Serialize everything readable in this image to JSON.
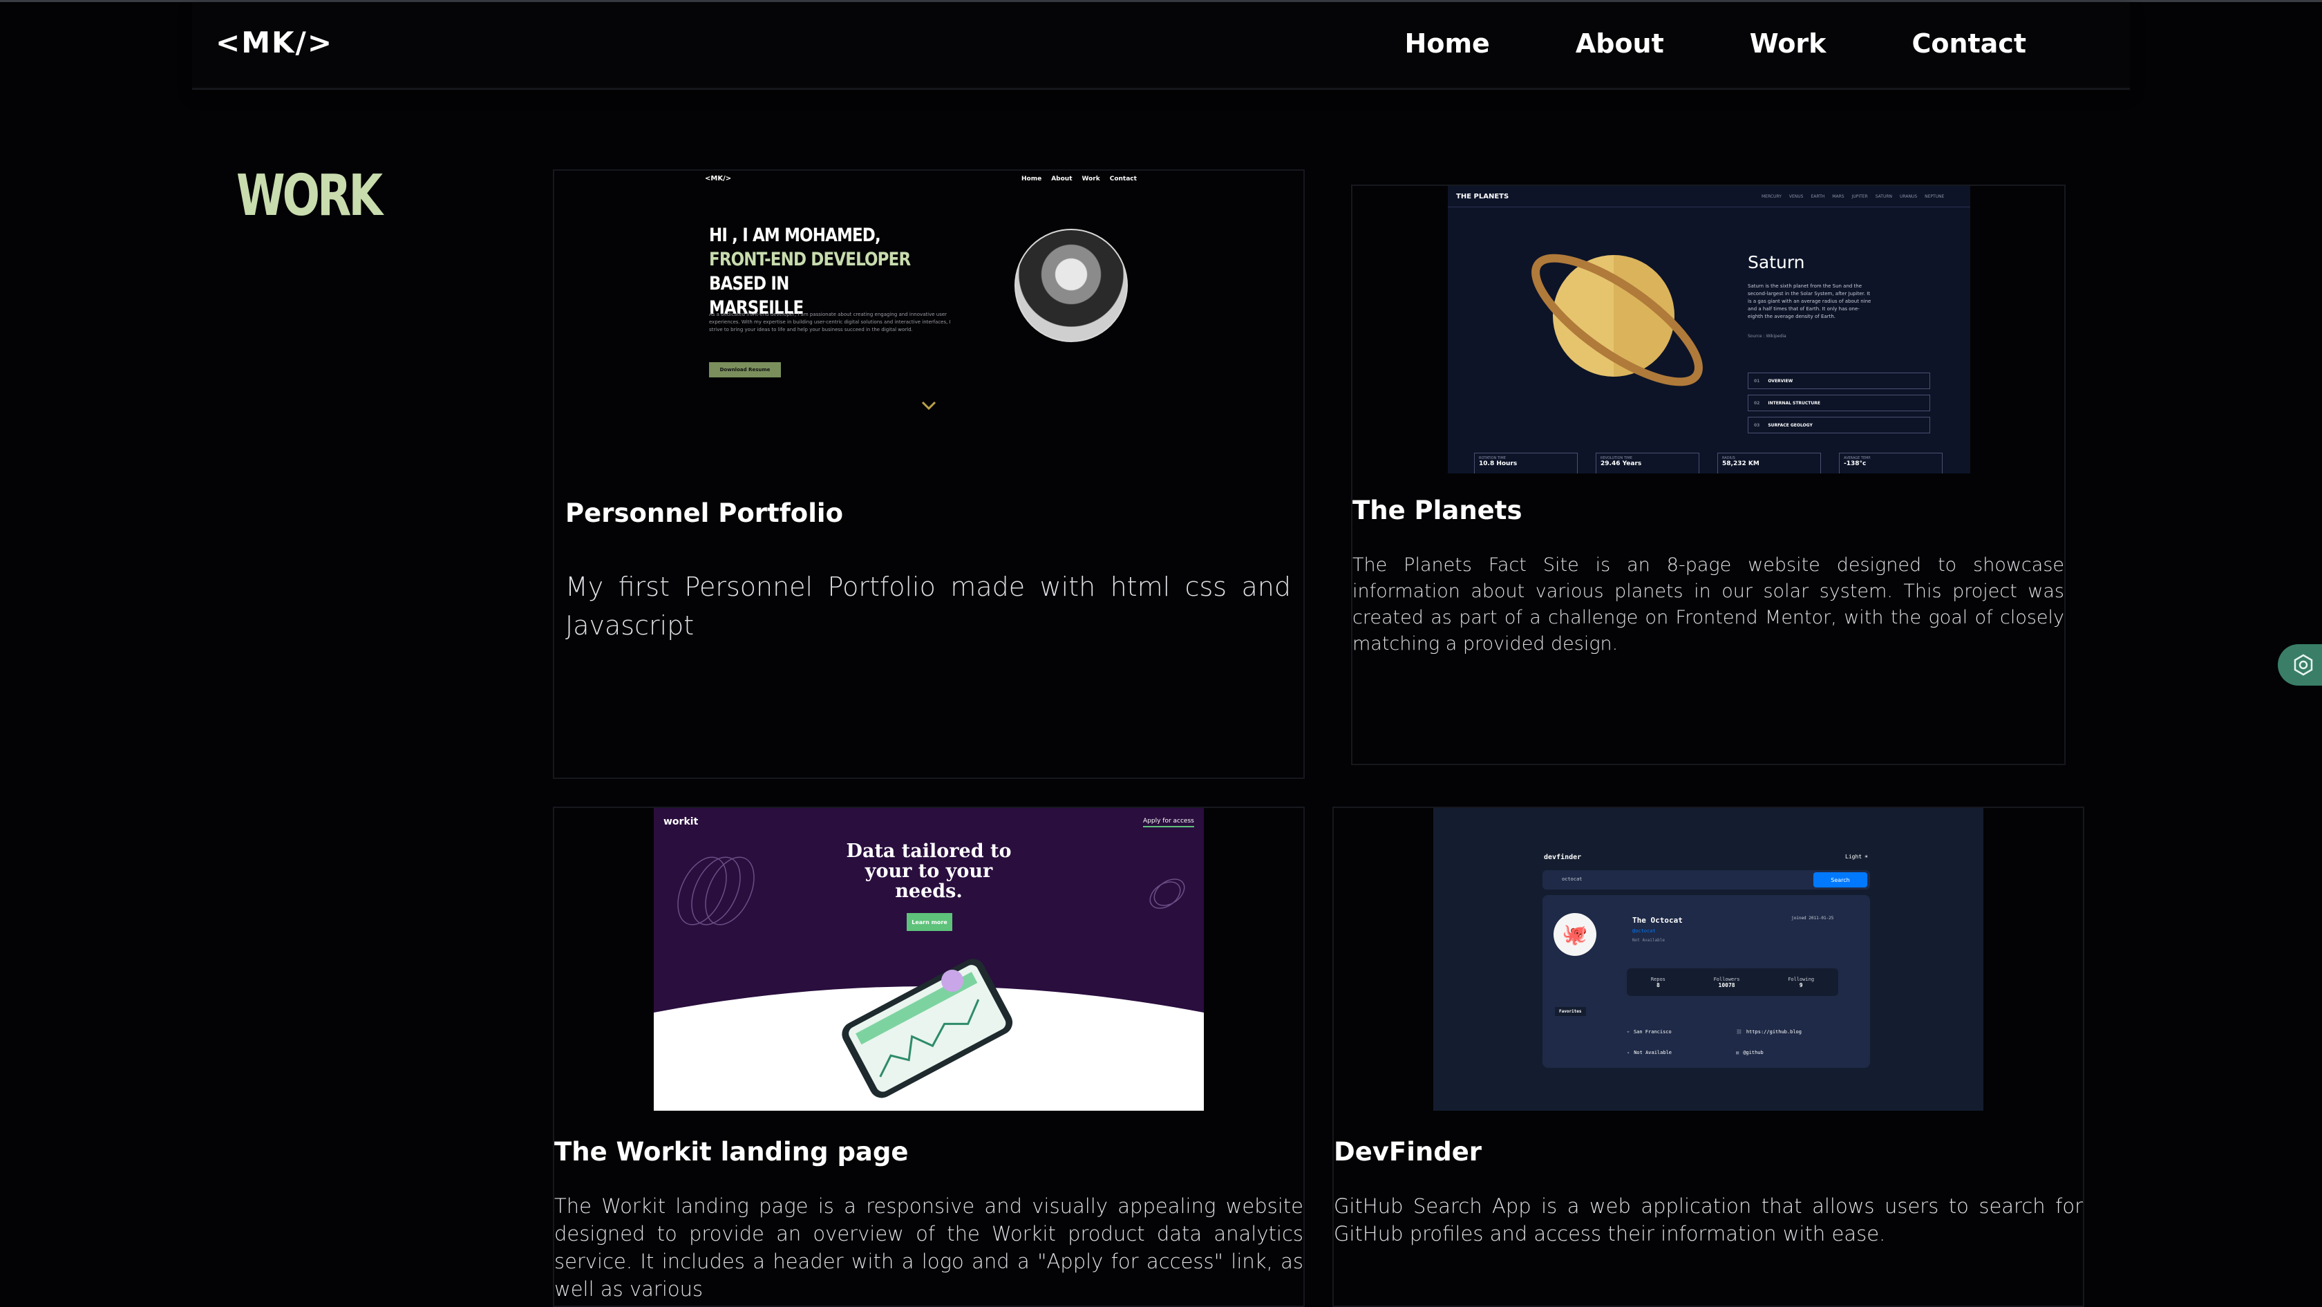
{
  "header": {
    "logo": "<MK/>",
    "nav": [
      "Home",
      "About",
      "Work",
      "Contact"
    ]
  },
  "section_title": "WORK",
  "projects": [
    {
      "title": "Personnel Portfolio",
      "description": "My first Personnel Portfolio made with html css and Javascript",
      "preview": {
        "logo": "<MK/>",
        "nav": [
          "Home",
          "About",
          "Work",
          "Contact"
        ],
        "line1": "HI , I AM MOHAMED,",
        "line2_accent": "FRONT-END DEVELOPER",
        "line2_rest": " BASED IN",
        "line3": "MARSEILLE",
        "body": "As a dedicated front-end developer, I am passionate about creating engaging and innovative user experiences. With my expertise in building user-centric digital solutions and interactive interfaces, I strive to bring your ideas to life and help your business succeed in the digital world.",
        "button": "Download Resume"
      }
    },
    {
      "title": "The Planets",
      "description": "The Planets Fact Site is an 8-page website designed to showcase information about various planets in our solar system. This project was created as part of a challenge on Frontend Mentor, with the goal of closely matching a provided design.",
      "preview": {
        "brand": "THE PLANETS",
        "nav": [
          "MERCURY",
          "VENUS",
          "EARTH",
          "MARS",
          "JUPITER",
          "SATURN",
          "URANUS",
          "NEPTUNE"
        ],
        "planet": "Saturn",
        "body": "Saturn is the sixth planet from the Sun and the second-largest in the Solar System, after Jupiter. It is a gas giant with an average radius of about nine and a half times that of Earth. It only has one-eighth the average density of Earth.",
        "source": "Source : Wikipedia",
        "tabs": [
          {
            "num": "01",
            "label": "OVERVIEW"
          },
          {
            "num": "02",
            "label": "INTERNAL STRUCTURE"
          },
          {
            "num": "03",
            "label": "SURFACE GEOLOGY"
          }
        ],
        "stats": [
          {
            "label": "ROTATION TIME",
            "value": "10.8 Hours"
          },
          {
            "label": "REVOLUTION TIME",
            "value": "29.46 Years"
          },
          {
            "label": "RADIUS",
            "value": "58,232 KM"
          },
          {
            "label": "AVERAGE TEMP.",
            "value": "-138°c"
          }
        ]
      }
    },
    {
      "title": "The Workit landing page",
      "description": "The Workit landing page is a responsive and visually appealing website designed to provide an overview of the Workit product data analytics service. It includes a header with a logo and a \"Apply for access\" link, as well as various",
      "preview": {
        "logo": "workit",
        "link": "Apply for access",
        "headline1": "Data tailored to",
        "headline2": "your to your",
        "headline3": "needs.",
        "button": "Learn more"
      }
    },
    {
      "title": "DevFinder",
      "description": "GitHub Search App is a web application that allows users to search for GitHub profiles and access their information with ease.",
      "preview": {
        "brand": "devfinder",
        "mode": "Light",
        "search_value": "octocat",
        "search_button": "Search",
        "name": "The Octocat",
        "handle": "@octocat",
        "joined": "joined 2011-01-25",
        "bio": "Not Available",
        "stats": [
          {
            "label": "Repos",
            "value": "8"
          },
          {
            "label": "Followers",
            "value": "10078"
          },
          {
            "label": "Following",
            "value": "9"
          }
        ],
        "favorites": "Favorites",
        "location": "San Francisco",
        "blog": "https://github.blog",
        "twitter": "Not Available",
        "company": "@github"
      }
    }
  ],
  "colors": {
    "background": "#030305",
    "accent_green": "#c8dcae",
    "settings_tab": "#3a7e68"
  }
}
